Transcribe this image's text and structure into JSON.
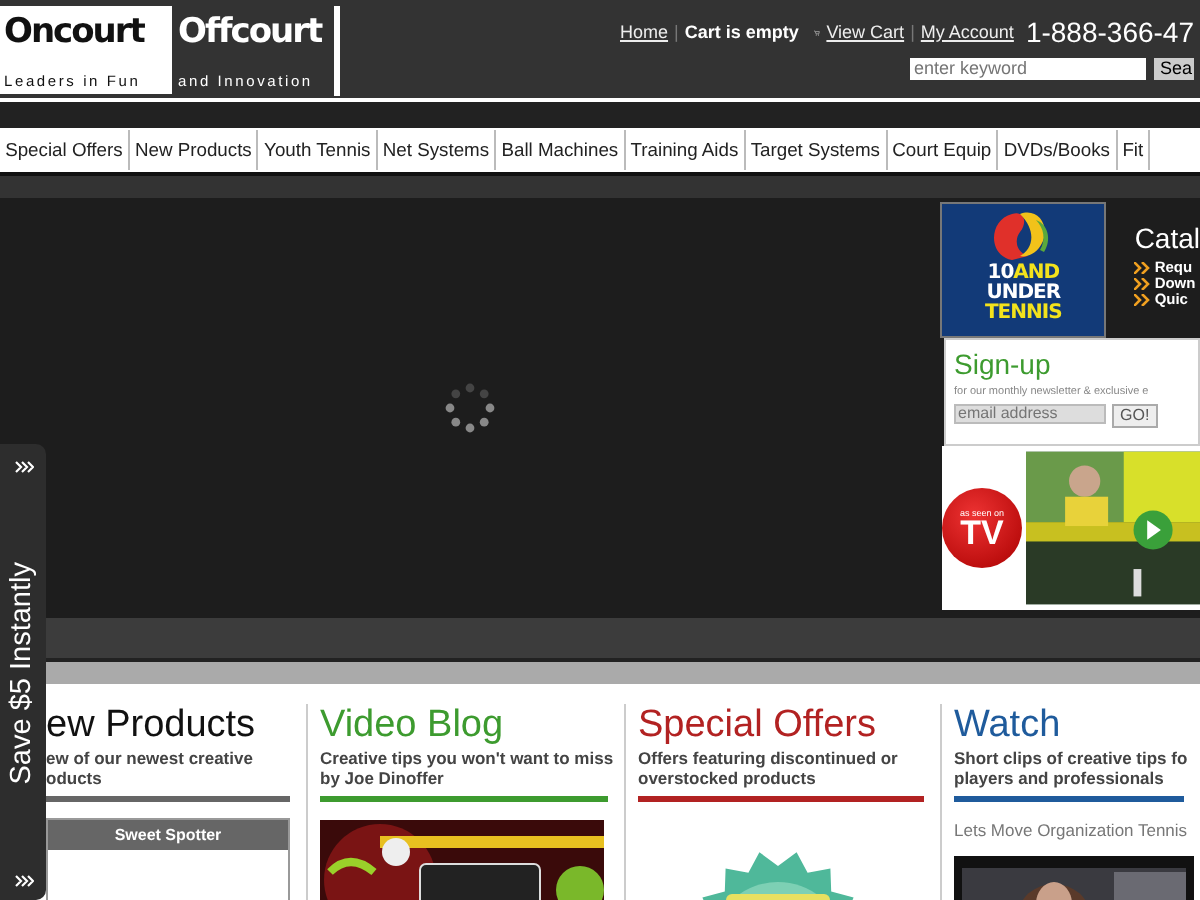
{
  "header": {
    "logo": {
      "word_1": "Oncourt",
      "word_2": "Offcourt",
      "tagline_1": "Leaders in Fun",
      "tagline_2": "and Innovation"
    },
    "links": [
      {
        "text": "Home",
        "kind": "link"
      },
      {
        "text": "Cart is empty",
        "kind": "status"
      },
      {
        "text": "View Cart",
        "kind": "cart"
      },
      {
        "text": "My Account",
        "kind": "link"
      }
    ],
    "separator": "|",
    "phone": "1-888-366-47",
    "search": {
      "placeholder": "enter keyword",
      "button": "Sea"
    }
  },
  "nav": [
    "Special Offers",
    "New Products",
    "Youth Tennis",
    "Net Systems",
    "Ball Machines",
    "Training Aids",
    "Target Systems",
    "Court Equip",
    "DVDs/Books",
    "Fit"
  ],
  "promo": {
    "logo_lines": [
      [
        {
          "text": "10",
          "color": "#ffffff"
        },
        {
          "text": "AND",
          "color": "#f3e21c"
        }
      ],
      [
        {
          "text": "UNDER",
          "color": "#ffffff"
        }
      ],
      [
        {
          "text": "TENNIS",
          "color": "#f3e21c"
        }
      ]
    ],
    "catalog_title": "Catal",
    "catalog_links": [
      "Requ",
      "Down",
      "Quic"
    ]
  },
  "signup": {
    "title": "Sign-up",
    "text": "for our monthly newsletter & exclusive e",
    "placeholder": "email address",
    "button": "GO!"
  },
  "tv_badge": {
    "small": "as seen on",
    "big": "TV"
  },
  "side_tab": "Save $5 Instantly",
  "columns": [
    {
      "title": "ew Products",
      "subtitle_lines": [
        "ew of our newest creative",
        "oducts"
      ],
      "color": "#666666",
      "content": {
        "kind": "product_box",
        "label": "Sweet Spotter"
      }
    },
    {
      "title": "Video Blog",
      "subtitle_lines": [
        "Creative tips you won't want to miss",
        "by Joe Dinoffer"
      ],
      "color": "#3d9b2f",
      "content": {
        "kind": "vlog_picture"
      }
    },
    {
      "title": "Special Offers",
      "subtitle_lines": [
        "Offers featuring discontinued or",
        "overstocked products"
      ],
      "color": "#b22222",
      "content": {
        "kind": "starburst_picture"
      }
    },
    {
      "title": "Watch",
      "subtitle_lines": [
        "Short clips of creative tips fo",
        "players and professionals"
      ],
      "color": "#1f5b9c",
      "content": {
        "kind": "video",
        "caption": "Lets Move Organization Tennis"
      }
    }
  ]
}
